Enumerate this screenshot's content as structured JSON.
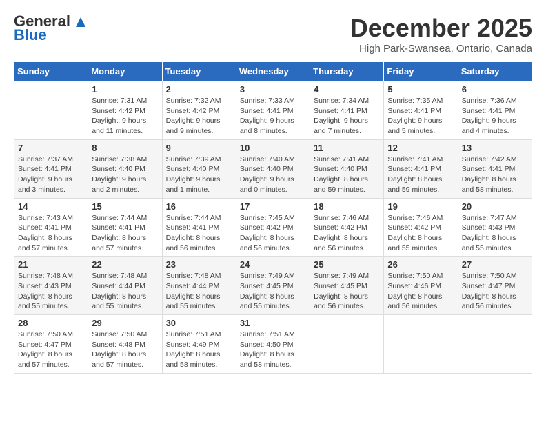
{
  "header": {
    "logo_line1": "General",
    "logo_line2": "Blue",
    "month_title": "December 2025",
    "location": "High Park-Swansea, Ontario, Canada"
  },
  "weekdays": [
    "Sunday",
    "Monday",
    "Tuesday",
    "Wednesday",
    "Thursday",
    "Friday",
    "Saturday"
  ],
  "weeks": [
    [
      {
        "day": "",
        "info": ""
      },
      {
        "day": "1",
        "info": "Sunrise: 7:31 AM\nSunset: 4:42 PM\nDaylight: 9 hours\nand 11 minutes."
      },
      {
        "day": "2",
        "info": "Sunrise: 7:32 AM\nSunset: 4:42 PM\nDaylight: 9 hours\nand 9 minutes."
      },
      {
        "day": "3",
        "info": "Sunrise: 7:33 AM\nSunset: 4:41 PM\nDaylight: 9 hours\nand 8 minutes."
      },
      {
        "day": "4",
        "info": "Sunrise: 7:34 AM\nSunset: 4:41 PM\nDaylight: 9 hours\nand 7 minutes."
      },
      {
        "day": "5",
        "info": "Sunrise: 7:35 AM\nSunset: 4:41 PM\nDaylight: 9 hours\nand 5 minutes."
      },
      {
        "day": "6",
        "info": "Sunrise: 7:36 AM\nSunset: 4:41 PM\nDaylight: 9 hours\nand 4 minutes."
      }
    ],
    [
      {
        "day": "7",
        "info": "Sunrise: 7:37 AM\nSunset: 4:41 PM\nDaylight: 9 hours\nand 3 minutes."
      },
      {
        "day": "8",
        "info": "Sunrise: 7:38 AM\nSunset: 4:40 PM\nDaylight: 9 hours\nand 2 minutes."
      },
      {
        "day": "9",
        "info": "Sunrise: 7:39 AM\nSunset: 4:40 PM\nDaylight: 9 hours\nand 1 minute."
      },
      {
        "day": "10",
        "info": "Sunrise: 7:40 AM\nSunset: 4:40 PM\nDaylight: 9 hours\nand 0 minutes."
      },
      {
        "day": "11",
        "info": "Sunrise: 7:41 AM\nSunset: 4:40 PM\nDaylight: 8 hours\nand 59 minutes."
      },
      {
        "day": "12",
        "info": "Sunrise: 7:41 AM\nSunset: 4:41 PM\nDaylight: 8 hours\nand 59 minutes."
      },
      {
        "day": "13",
        "info": "Sunrise: 7:42 AM\nSunset: 4:41 PM\nDaylight: 8 hours\nand 58 minutes."
      }
    ],
    [
      {
        "day": "14",
        "info": "Sunrise: 7:43 AM\nSunset: 4:41 PM\nDaylight: 8 hours\nand 57 minutes."
      },
      {
        "day": "15",
        "info": "Sunrise: 7:44 AM\nSunset: 4:41 PM\nDaylight: 8 hours\nand 57 minutes."
      },
      {
        "day": "16",
        "info": "Sunrise: 7:44 AM\nSunset: 4:41 PM\nDaylight: 8 hours\nand 56 minutes."
      },
      {
        "day": "17",
        "info": "Sunrise: 7:45 AM\nSunset: 4:42 PM\nDaylight: 8 hours\nand 56 minutes."
      },
      {
        "day": "18",
        "info": "Sunrise: 7:46 AM\nSunset: 4:42 PM\nDaylight: 8 hours\nand 56 minutes."
      },
      {
        "day": "19",
        "info": "Sunrise: 7:46 AM\nSunset: 4:42 PM\nDaylight: 8 hours\nand 55 minutes."
      },
      {
        "day": "20",
        "info": "Sunrise: 7:47 AM\nSunset: 4:43 PM\nDaylight: 8 hours\nand 55 minutes."
      }
    ],
    [
      {
        "day": "21",
        "info": "Sunrise: 7:48 AM\nSunset: 4:43 PM\nDaylight: 8 hours\nand 55 minutes."
      },
      {
        "day": "22",
        "info": "Sunrise: 7:48 AM\nSunset: 4:44 PM\nDaylight: 8 hours\nand 55 minutes."
      },
      {
        "day": "23",
        "info": "Sunrise: 7:48 AM\nSunset: 4:44 PM\nDaylight: 8 hours\nand 55 minutes."
      },
      {
        "day": "24",
        "info": "Sunrise: 7:49 AM\nSunset: 4:45 PM\nDaylight: 8 hours\nand 55 minutes."
      },
      {
        "day": "25",
        "info": "Sunrise: 7:49 AM\nSunset: 4:45 PM\nDaylight: 8 hours\nand 56 minutes."
      },
      {
        "day": "26",
        "info": "Sunrise: 7:50 AM\nSunset: 4:46 PM\nDaylight: 8 hours\nand 56 minutes."
      },
      {
        "day": "27",
        "info": "Sunrise: 7:50 AM\nSunset: 4:47 PM\nDaylight: 8 hours\nand 56 minutes."
      }
    ],
    [
      {
        "day": "28",
        "info": "Sunrise: 7:50 AM\nSunset: 4:47 PM\nDaylight: 8 hours\nand 57 minutes."
      },
      {
        "day": "29",
        "info": "Sunrise: 7:50 AM\nSunset: 4:48 PM\nDaylight: 8 hours\nand 57 minutes."
      },
      {
        "day": "30",
        "info": "Sunrise: 7:51 AM\nSunset: 4:49 PM\nDaylight: 8 hours\nand 58 minutes."
      },
      {
        "day": "31",
        "info": "Sunrise: 7:51 AM\nSunset: 4:50 PM\nDaylight: 8 hours\nand 58 minutes."
      },
      {
        "day": "",
        "info": ""
      },
      {
        "day": "",
        "info": ""
      },
      {
        "day": "",
        "info": ""
      }
    ]
  ]
}
